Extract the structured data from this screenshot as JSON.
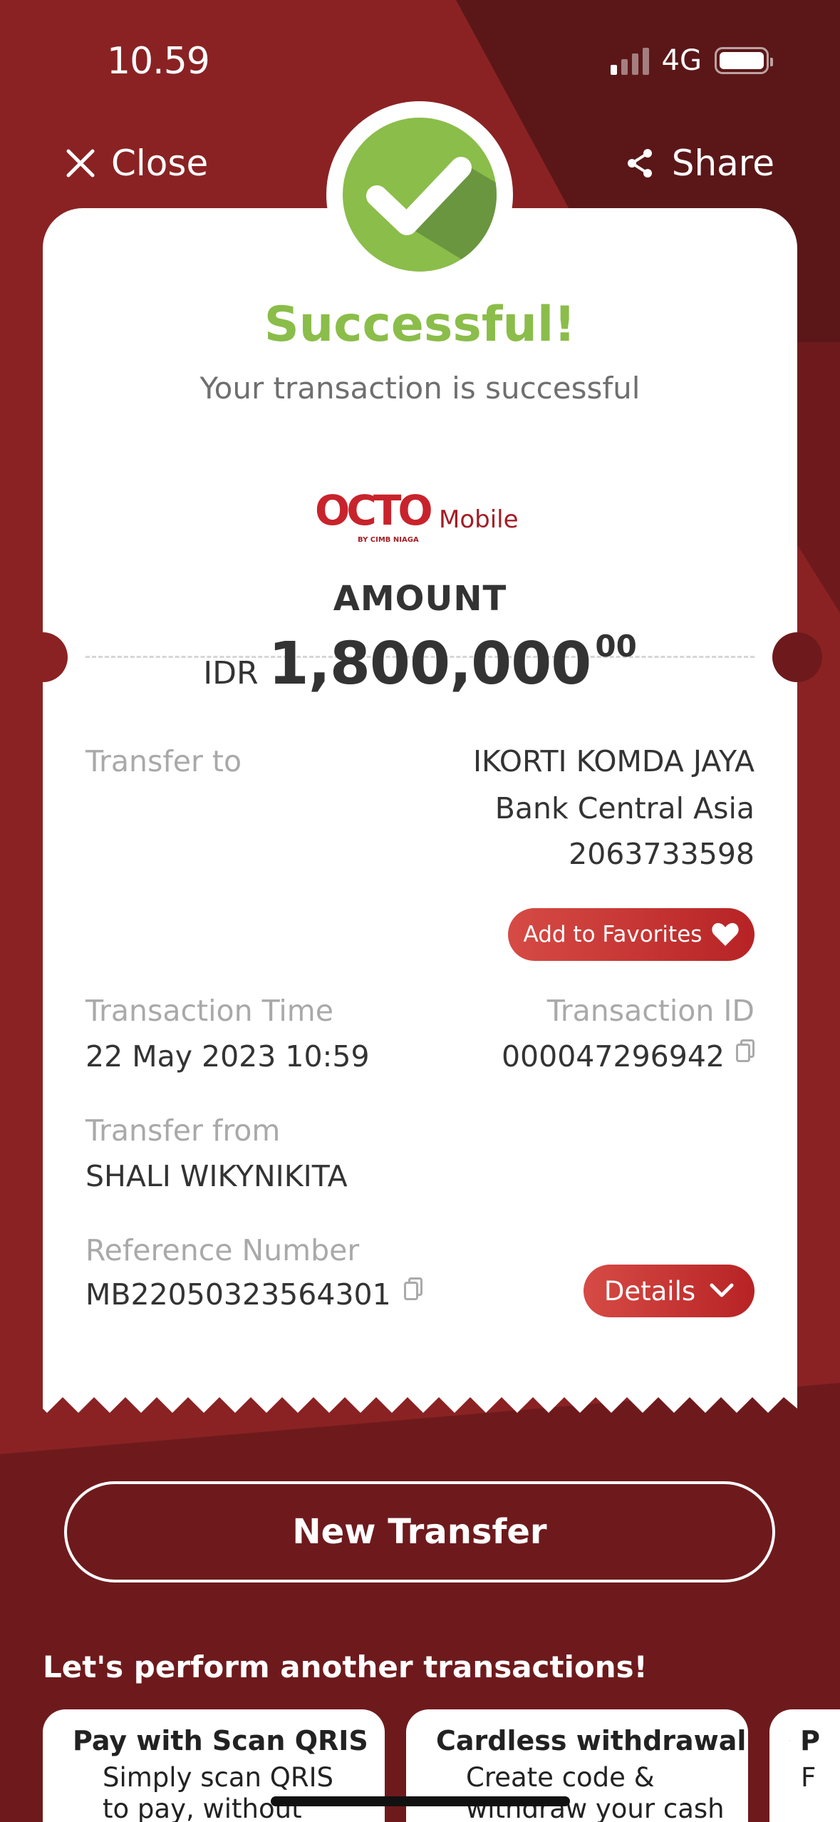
{
  "status_bar": {
    "time": "10.59",
    "network": "4G"
  },
  "header": {
    "close_label": "Close",
    "share_label": "Share"
  },
  "result": {
    "title": "Successful!",
    "subtitle": "Your transaction is successful"
  },
  "brand": {
    "name": "OCTO",
    "suffix": "Mobile",
    "byline": "BY CIMB NIAGA",
    "color": "#c8232c"
  },
  "amount": {
    "label": "AMOUNT",
    "currency": "IDR",
    "value": "1,800,000",
    "decimals": "00"
  },
  "transfer_to": {
    "label": "Transfer to",
    "name": "IKORTI KOMDA JAYA",
    "bank": "Bank Central Asia",
    "account": "2063733598",
    "favorites_label": "Add to Favorites"
  },
  "transaction_time": {
    "label": "Transaction Time",
    "value": "22 May 2023 10:59"
  },
  "transaction_id": {
    "label": "Transaction ID",
    "value": "000047296942"
  },
  "transfer_from": {
    "label": "Transfer from",
    "value": "SHALI WIKYNIKITA"
  },
  "reference": {
    "label": "Reference Number",
    "value": "MB22050323564301",
    "details_label": "Details"
  },
  "actions": {
    "new_transfer_label": "New Transfer"
  },
  "more": {
    "title": "Let's perform another transactions!",
    "tiles": [
      {
        "icon": "qris-icon",
        "title": "Pay with Scan QRIS",
        "desc": "Simply scan QRIS to pay, without card and"
      },
      {
        "icon": "atm-icon",
        "title": "Cardless withdrawal",
        "desc": "Create code & withdraw your cash"
      },
      {
        "icon": "bill-icon",
        "title": "P",
        "desc": "F"
      }
    ]
  },
  "colors": {
    "success": "#8bbd4a",
    "accent": "#c8232c",
    "background": "#6e1a1d"
  }
}
